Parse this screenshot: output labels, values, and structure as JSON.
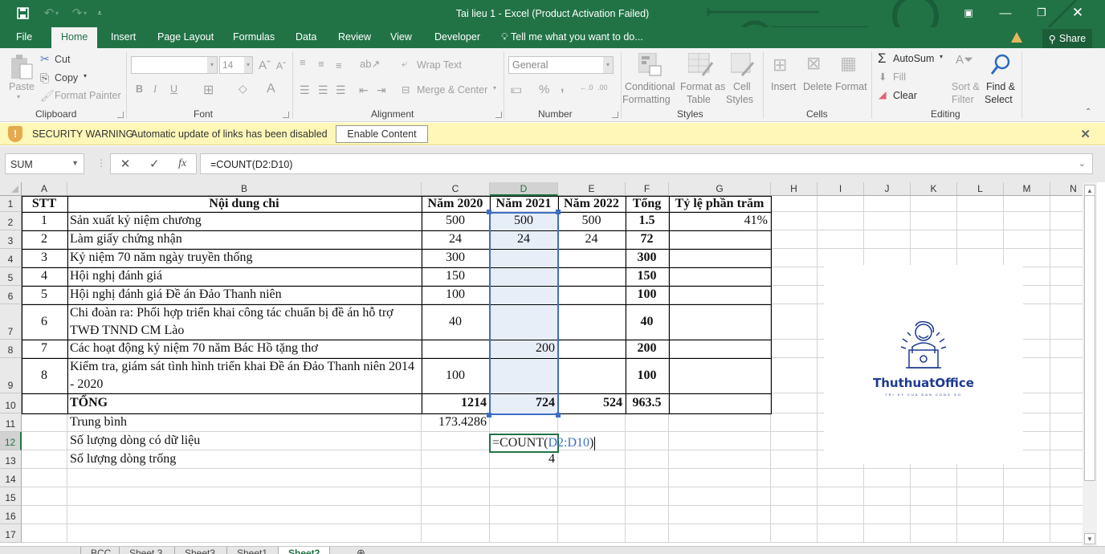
{
  "window": {
    "title": "Tai lieu 1 - Excel (Product Activation Failed)"
  },
  "quick_access": {
    "save_icon": "save-icon",
    "undo_icon": "undo-icon",
    "redo_icon": "redo-icon",
    "customize_icon": "customize-qat-icon"
  },
  "ribbon_tabs": [
    {
      "label": "File"
    },
    {
      "label": "Home",
      "active": true
    },
    {
      "label": "Insert"
    },
    {
      "label": "Page Layout"
    },
    {
      "label": "Formulas"
    },
    {
      "label": "Data"
    },
    {
      "label": "Review"
    },
    {
      "label": "View"
    },
    {
      "label": "Developer"
    }
  ],
  "tell_me": "Tell me what you want to do...",
  "share_label": "Share",
  "ribbon": {
    "clipboard": {
      "paste": "Paste",
      "cut": "Cut",
      "copy": "Copy",
      "format_painter": "Format Painter",
      "label": "Clipboard"
    },
    "font": {
      "font_name": "",
      "font_size": "14",
      "bold": "B",
      "italic": "I",
      "underline": "U",
      "font_color": "A",
      "label": "Font"
    },
    "alignment": {
      "wrap_text": "Wrap Text",
      "merge_center": "Merge & Center",
      "label": "Alignment"
    },
    "number": {
      "format": "General",
      "percent": "%",
      "comma": ",",
      "label": "Number"
    },
    "styles": {
      "conditional_1": "Conditional",
      "conditional_2": "Formatting",
      "format_table_1": "Format as",
      "format_table_2": "Table",
      "cell_styles_1": "Cell",
      "cell_styles_2": "Styles",
      "label": "Styles"
    },
    "cells": {
      "insert": "Insert",
      "delete": "Delete",
      "format": "Format",
      "label": "Cells"
    },
    "editing": {
      "autosum": "AutoSum",
      "fill": "Fill",
      "clear": "Clear",
      "sort_1": "Sort &",
      "sort_2": "Filter",
      "find_1": "Find &",
      "find_2": "Select",
      "label": "Editing"
    }
  },
  "security_bar": {
    "label": "SECURITY WARNING",
    "message": "Automatic update of links has been disabled",
    "button": "Enable Content"
  },
  "formula_bar": {
    "name_box": "SUM",
    "cancel": "✕",
    "enter": "✓",
    "fx": "fx",
    "formula": "=COUNT(D2:D10)"
  },
  "columns": [
    "A",
    "B",
    "C",
    "D",
    "E",
    "F",
    "G",
    "H",
    "I",
    "J",
    "K",
    "L",
    "M",
    "N"
  ],
  "rows": [
    "1",
    "2",
    "3",
    "4",
    "5",
    "6",
    "7",
    "8",
    "9",
    "10",
    "11",
    "12",
    "13",
    "14",
    "15",
    "16",
    "17"
  ],
  "table": {
    "headers": [
      "STT",
      "Nội dung chi",
      "Năm 2020",
      "Năm 2021",
      "Năm 2022",
      "Tổng",
      "Tỷ lệ phần trăm"
    ],
    "rows": [
      {
        "stt": "1",
        "content": "Sản xuất kỷ niệm chương",
        "y2020": "500",
        "y2021": "500",
        "y2022": "500",
        "total": "1.5",
        "pct": "41%"
      },
      {
        "stt": "2",
        "content": "Làm giấy chứng nhận",
        "y2020": "24",
        "y2021": "24",
        "y2022": "24",
        "total": "72",
        "pct": ""
      },
      {
        "stt": "3",
        "content": "Kỷ niệm 70 năm ngày truyền thống",
        "y2020": "300",
        "y2021": "",
        "y2022": "",
        "total": "300",
        "pct": ""
      },
      {
        "stt": "4",
        "content": "Hội nghị đánh giá",
        "y2020": "150",
        "y2021": "",
        "y2022": "",
        "total": "150",
        "pct": ""
      },
      {
        "stt": "5",
        "content": "Hội nghị đánh giá Đề án Đảo Thanh niên",
        "y2020": "100",
        "y2021": "",
        "y2022": "",
        "total": "100",
        "pct": ""
      },
      {
        "stt": "6",
        "content": "Chi đoàn ra: Phối hợp triển khai công tác chuẩn bị đề án hỗ trợ TWĐ TNND CM Lào",
        "y2020": "40",
        "y2021": "",
        "y2022": "",
        "total": "40",
        "pct": ""
      },
      {
        "stt": "7",
        "content": "Các hoạt động kỷ niệm 70 năm Bác Hồ tặng thơ",
        "y2020": "",
        "y2021": "200",
        "y2022": "",
        "total": "200",
        "pct": ""
      },
      {
        "stt": "8",
        "content": "Kiểm tra, giám sát tình hình triển khai Đề án Đảo Thanh niên 2014 - 2020",
        "y2020": "100",
        "y2021": "",
        "y2022": "",
        "total": "100",
        "pct": ""
      }
    ],
    "total_row": {
      "label": "TỔNG",
      "y2020": "1214",
      "y2021": "724",
      "y2022": "524",
      "total": "963.5"
    }
  },
  "extra_rows": {
    "average_label": "Trung bình",
    "average_value": "173.4286",
    "count_label": "Số lượng dòng có dữ liệu",
    "count_formula_prefix": "=COUNT(",
    "count_formula_ref": "D2:D10",
    "count_formula_suffix": ")",
    "blank_label": "Số lượng dòng trống",
    "blank_value": "4"
  },
  "logo": {
    "name": "ThuthuatOffice",
    "tagline": "TRI KY CUA DAN CONG SO"
  },
  "sheet_tabs": [
    {
      "label": "BCC"
    },
    {
      "label": "Sheet 3"
    },
    {
      "label": "Sheet3"
    },
    {
      "label": "Sheet1"
    },
    {
      "label": "Sheet2",
      "active": true
    }
  ],
  "colors": {
    "excel_green": "#217346",
    "selection_blue": "#3b6fc4",
    "security_bar": "#fff7b8"
  }
}
